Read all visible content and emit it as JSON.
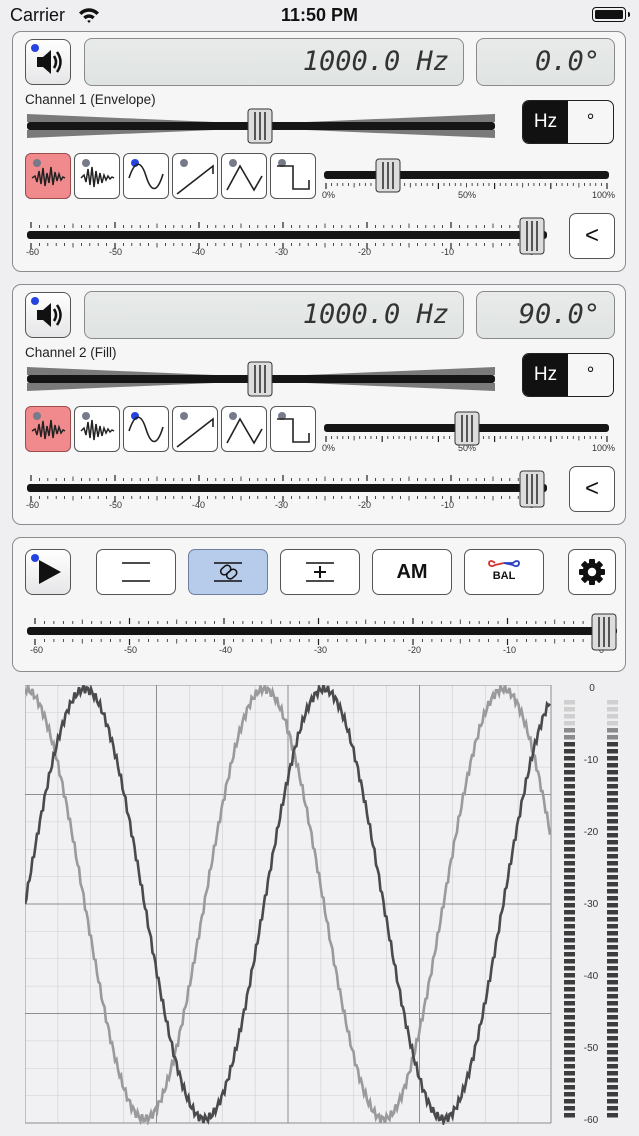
{
  "status_bar": {
    "carrier": "Carrier",
    "time": "11:50 PM"
  },
  "channel1": {
    "frequency": "1000.0 Hz",
    "phase": "0.0°",
    "label": "Channel 1 (Envelope)",
    "unit_options": [
      "Hz",
      "°"
    ],
    "unit_selected": "Hz",
    "selected_waveform": "white-noise",
    "waveforms": [
      "white-noise",
      "pink-noise",
      "sine",
      "sawtooth",
      "triangle",
      "square"
    ],
    "duty_ticks": [
      "0%",
      "50%",
      "100%"
    ],
    "duty_value": 0.22,
    "level_ticks": [
      "-60",
      "-50",
      "-40",
      "-30",
      "-20",
      "-10",
      "0"
    ],
    "level_value": 0,
    "back_label": "<"
  },
  "channel2": {
    "frequency": "1000.0 Hz",
    "phase": "90.0°",
    "label": "Channel 2 (Fill)",
    "unit_options": [
      "Hz",
      "°"
    ],
    "unit_selected": "Hz",
    "selected_waveform": "white-noise",
    "waveforms": [
      "white-noise",
      "pink-noise",
      "sine",
      "sawtooth",
      "triangle",
      "square"
    ],
    "duty_ticks": [
      "0%",
      "50%",
      "100%"
    ],
    "duty_value": 0.5,
    "level_ticks": [
      "-60",
      "-50",
      "-40",
      "-30",
      "-20",
      "-10",
      "0"
    ],
    "level_value": 0,
    "back_label": "<"
  },
  "transport": {
    "modes": [
      "separate",
      "link",
      "sum",
      "AM",
      "BAL"
    ],
    "am_label": "AM",
    "bal_label": "BAL",
    "active_mode": "link",
    "master_ticks": [
      "-60",
      "-50",
      "-40",
      "-30",
      "-20",
      "-10",
      "0"
    ],
    "master_value": 0
  },
  "vu_meter": {
    "scale": [
      "0",
      "-10",
      "-20",
      "-30",
      "-40",
      "-50",
      "-60"
    ]
  },
  "colors": {
    "selected_waveform_bg": "#f08a8d",
    "active_mode_bg": "#b7cbea",
    "indicator_blue": "#2443e0",
    "bal_red": "#d8322e",
    "bal_blue": "#2a3fc2"
  }
}
